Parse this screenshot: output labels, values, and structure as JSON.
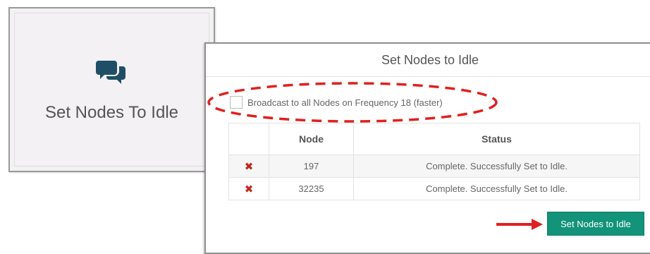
{
  "tile": {
    "icon": "chat-bubbles-icon",
    "label": "Set Nodes To Idle"
  },
  "dialog": {
    "title": "Set Nodes to Idle",
    "broadcast": {
      "label": "Broadcast to all Nodes on Frequency 18 (faster)",
      "checked": false
    },
    "table": {
      "headers": [
        "",
        "Node",
        "Status"
      ],
      "rows": [
        {
          "icon": "✖",
          "node": "197",
          "status": "Complete. Successfully Set to Idle."
        },
        {
          "icon": "✖",
          "node": "32235",
          "status": "Complete. Successfully Set to Idle."
        }
      ]
    },
    "submit_label": "Set Nodes to Idle"
  },
  "annotations": {
    "ellipse_color": "#e02020",
    "arrow_color": "#e02020"
  },
  "colors": {
    "button": "#12937a",
    "icon": "#1f4f66"
  }
}
